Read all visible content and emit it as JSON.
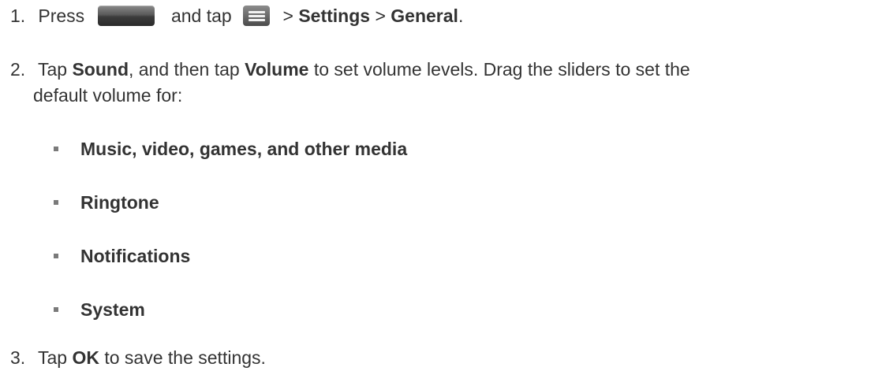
{
  "steps": [
    {
      "number": "1.",
      "press": "Press",
      "and_tap": "and tap",
      "sep1": ">",
      "settings": "Settings",
      "sep2": ">",
      "general": "General",
      "end": ".",
      "icons": [
        "home-key-icon",
        "menu-key-icon"
      ]
    },
    {
      "number": "2.",
      "tap": "Tap",
      "sound": "Sound",
      "and_then_tap": ", and then tap",
      "volume": "Volume",
      "rest_line1": "to set volume levels. Drag the sliders to set the",
      "line2": "default volume for:",
      "items": [
        "Music, video, games, and other media",
        "Ringtone",
        "Notifications",
        "System"
      ]
    },
    {
      "number": "3.",
      "tap": "Tap",
      "ok": "OK",
      "rest": "to save the settings."
    }
  ]
}
